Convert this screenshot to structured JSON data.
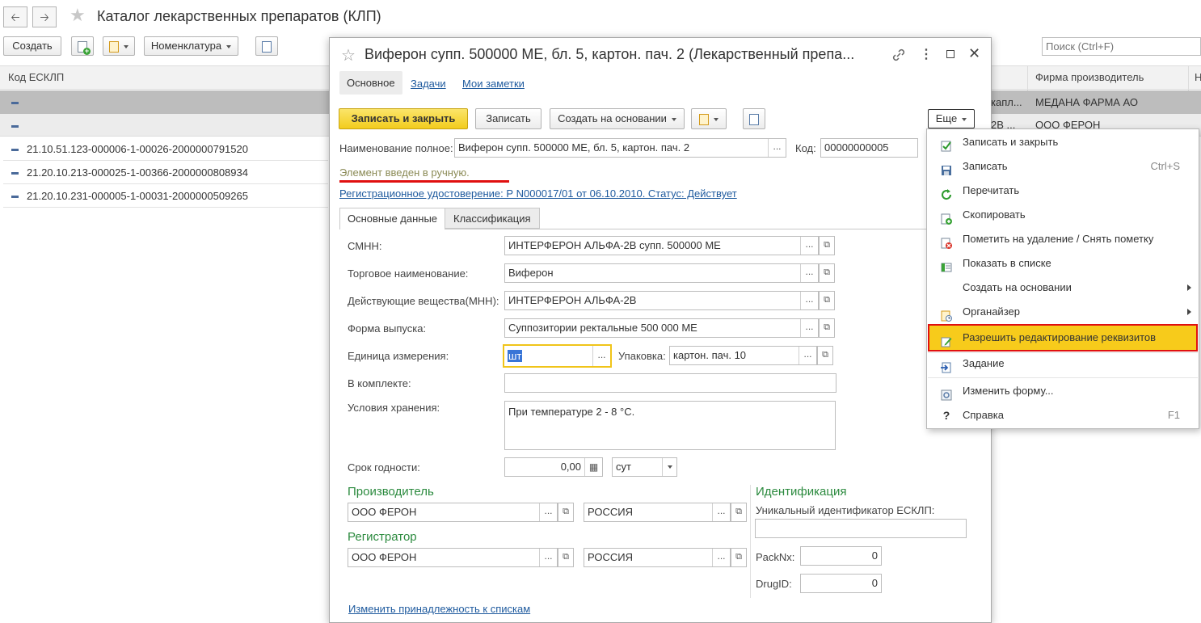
{
  "app": {
    "title": "Каталог лекарственных препаратов (КЛП)",
    "back_icon": "arrow-left-icon",
    "forward_icon": "arrow-right-icon",
    "star_icon": "star-icon"
  },
  "list_toolbar": {
    "create_label": "Создать",
    "nomenclature_label": "Номенклатура",
    "search_placeholder": "Поиск (Ctrl+F)"
  },
  "list": {
    "col_code": "Код ЕСКЛП",
    "col_firm": "Фирма производитель",
    "col_extra": "Н",
    "rows": [
      {
        "code": "",
        "firm": "МЕДАНА ФАРМА АО",
        "partial": "капл..."
      },
      {
        "code": "",
        "firm": "ООО ФЕРОН",
        "partial": "2В ..."
      },
      {
        "code": "21.10.51.123-000006-1-00026-2000000791520"
      },
      {
        "code": "21.20.10.213-000025-1-00366-2000000808934"
      },
      {
        "code": "21.20.10.231-000005-1-00031-2000000509265"
      }
    ]
  },
  "form": {
    "title": "Виферон супп. 500000 МЕ, бл. 5, картон. пач. 2 (Лекарственный препа...",
    "nav_tabs": [
      "Основное",
      "Задачи",
      "Мои заметки"
    ],
    "btn_save_close": "Записать и закрыть",
    "btn_save": "Записать",
    "btn_create_basis": "Создать на основании",
    "btn_more": "Еще",
    "full_name_label": "Наименование полное:",
    "full_name_value": "Виферон супп. 500000 МЕ, бл. 5, картон. пач. 2",
    "code_label": "Код:",
    "code_value": "00000000005",
    "manual_note": "Элемент введен в ручную.",
    "reg_link": "Регистрационное удостоверение: Р N000017/01 от 06.10.2010. Статус: Действует",
    "tabs": [
      "Основные данные",
      "Классификация"
    ],
    "smnn_label": "СМНН:",
    "smnn_value": "ИНТЕРФЕРОН АЛЬФА-2В супп. 500000 МЕ",
    "trade_label": "Торговое наименование:",
    "trade_value": "Виферон",
    "active_label": "Действующие вещества(МНН):",
    "active_value": "ИНТЕРФЕРОН АЛЬФА-2В",
    "form_label": "Форма выпуска:",
    "form_value": "Суппозитории ректальные 500 000 МЕ",
    "unit_label": "Единица измерения:",
    "unit_value": "шт",
    "pack_label": "Упаковка:",
    "pack_value": "картон. пач. 10",
    "kit_label": "В комплекте:",
    "kit_value": "",
    "storage_label": "Условия хранения:",
    "storage_value": "При температуре 2 - 8 °С.",
    "shelf_label": "Срок годности:",
    "shelf_value": "0,00",
    "shelf_unit": "сут",
    "producer_header": "Производитель",
    "producer_name": "ООО ФЕРОН",
    "producer_country": "РОССИЯ",
    "registrar_header": "Регистратор",
    "registrar_name": "ООО ФЕРОН",
    "registrar_country": "РОССИЯ",
    "ident_header": "Идентификация",
    "ident_label": "Уникальный идентификатор ЕСКЛП:",
    "ident_value": "",
    "packnx_label": "PackNx:",
    "packnx_value": "0",
    "drugid_label": "DrugID:",
    "drugid_value": "0",
    "change_link": "Изменить принадлежность к спискам"
  },
  "menu": {
    "items": [
      {
        "label": "Записать и закрыть",
        "shortcut": "",
        "icon": "save-close-icon"
      },
      {
        "label": "Записать",
        "shortcut": "Ctrl+S",
        "icon": "floppy-icon"
      },
      {
        "label": "Перечитать",
        "shortcut": "",
        "icon": "refresh-icon"
      },
      {
        "label": "Скопировать",
        "shortcut": "",
        "icon": "copy-icon"
      },
      {
        "label": "Пометить на удаление / Снять пометку",
        "shortcut": "",
        "icon": "delete-mark-icon"
      },
      {
        "label": "Показать в списке",
        "shortcut": "",
        "icon": "show-in-list-icon"
      },
      {
        "label": "Создать на основании",
        "shortcut": "",
        "icon": ""
      },
      {
        "label": "Органайзер",
        "shortcut": "",
        "icon": "organizer-icon"
      },
      {
        "label": "Разрешить редактирование реквизитов",
        "shortcut": "",
        "icon": "edit-icon"
      },
      {
        "label": "Задание",
        "shortcut": "",
        "icon": "task-icon"
      },
      {
        "label": "Изменить форму...",
        "shortcut": "",
        "icon": "form-settings-icon"
      },
      {
        "label": "Справка",
        "shortcut": "F1",
        "icon": "help-icon"
      }
    ],
    "help_glyph": "?"
  },
  "colors": {
    "accent_yellow": "#f5d327",
    "highlight_row": "#f7cb1b",
    "link": "#1e5a9e",
    "group_green": "#2b8a3e",
    "annotation_red": "#e01010"
  }
}
